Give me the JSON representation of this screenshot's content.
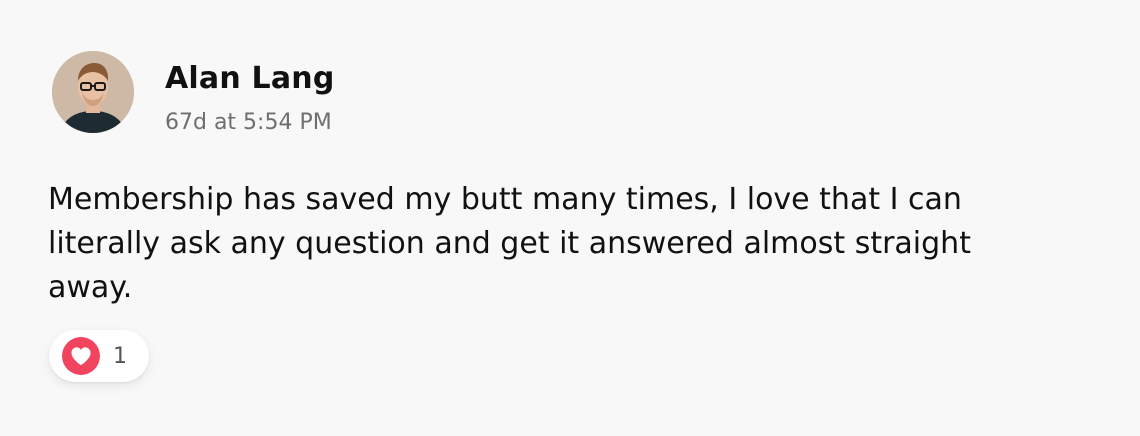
{
  "post": {
    "author": {
      "name": "Alan Lang",
      "avatar_icon": "user-avatar-photo"
    },
    "timestamp": "67d at 5:54 PM",
    "body": "Membership has saved my butt many times, I love that I can literally ask any question and get it answered almost straight away.",
    "reactions": {
      "icon": "heart-icon",
      "count": "1",
      "color": "#f0445f"
    }
  }
}
